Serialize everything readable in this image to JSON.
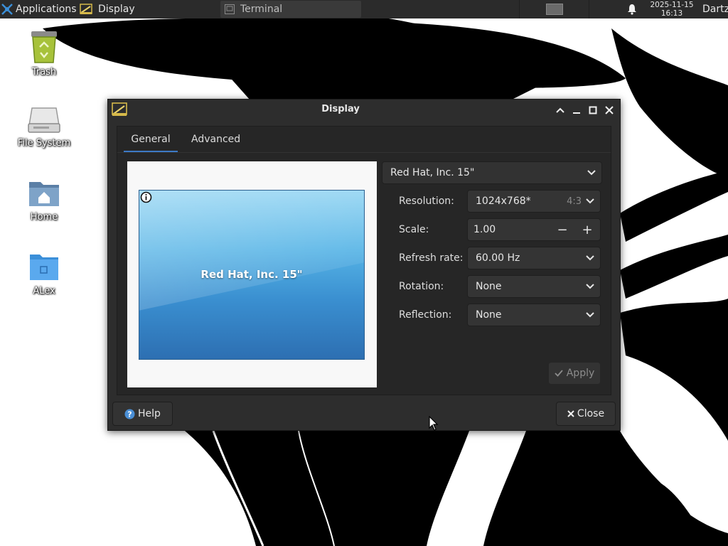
{
  "top_panel": {
    "applications_label": "Applications",
    "display_task_label": "Display",
    "terminal_task_label": "Terminal",
    "clock_date": "2025-11-15",
    "clock_time": "16:13",
    "user_label": "Dartz"
  },
  "desktop": {
    "icons": [
      {
        "label": "Trash",
        "icon": "trash-icon"
      },
      {
        "label": "File System",
        "icon": "drive-icon"
      },
      {
        "label": "Home",
        "icon": "home-folder-icon"
      },
      {
        "label": "ALex",
        "icon": "folder-icon"
      }
    ]
  },
  "dialog": {
    "title": "Display",
    "tabs": [
      {
        "label": "General",
        "selected": true
      },
      {
        "label": "Advanced",
        "selected": false
      }
    ],
    "preview": {
      "monitor_label": "Red Hat, Inc. 15\""
    },
    "monitor_select": "Red Hat, Inc. 15\"",
    "settings": {
      "resolution": {
        "label": "Resolution:",
        "value": "1024x768*",
        "ratio": "4:3"
      },
      "scale": {
        "label": "Scale:",
        "value": "1.00",
        "minus": "−",
        "plus": "+"
      },
      "refresh_rate": {
        "label": "Refresh rate:",
        "value": "60.00 Hz"
      },
      "rotation": {
        "label": "Rotation:",
        "value": "None"
      },
      "reflection": {
        "label": "Reflection:",
        "value": "None"
      }
    },
    "apply_label": "Apply",
    "help_label": "Help",
    "close_label": "Close"
  },
  "colors": {
    "panel_bg": "#2b2b2b",
    "dialog_bg": "#2d2d2d",
    "tab_accent": "#3c7ac6",
    "monitor_blue": "#3a8fd0"
  }
}
